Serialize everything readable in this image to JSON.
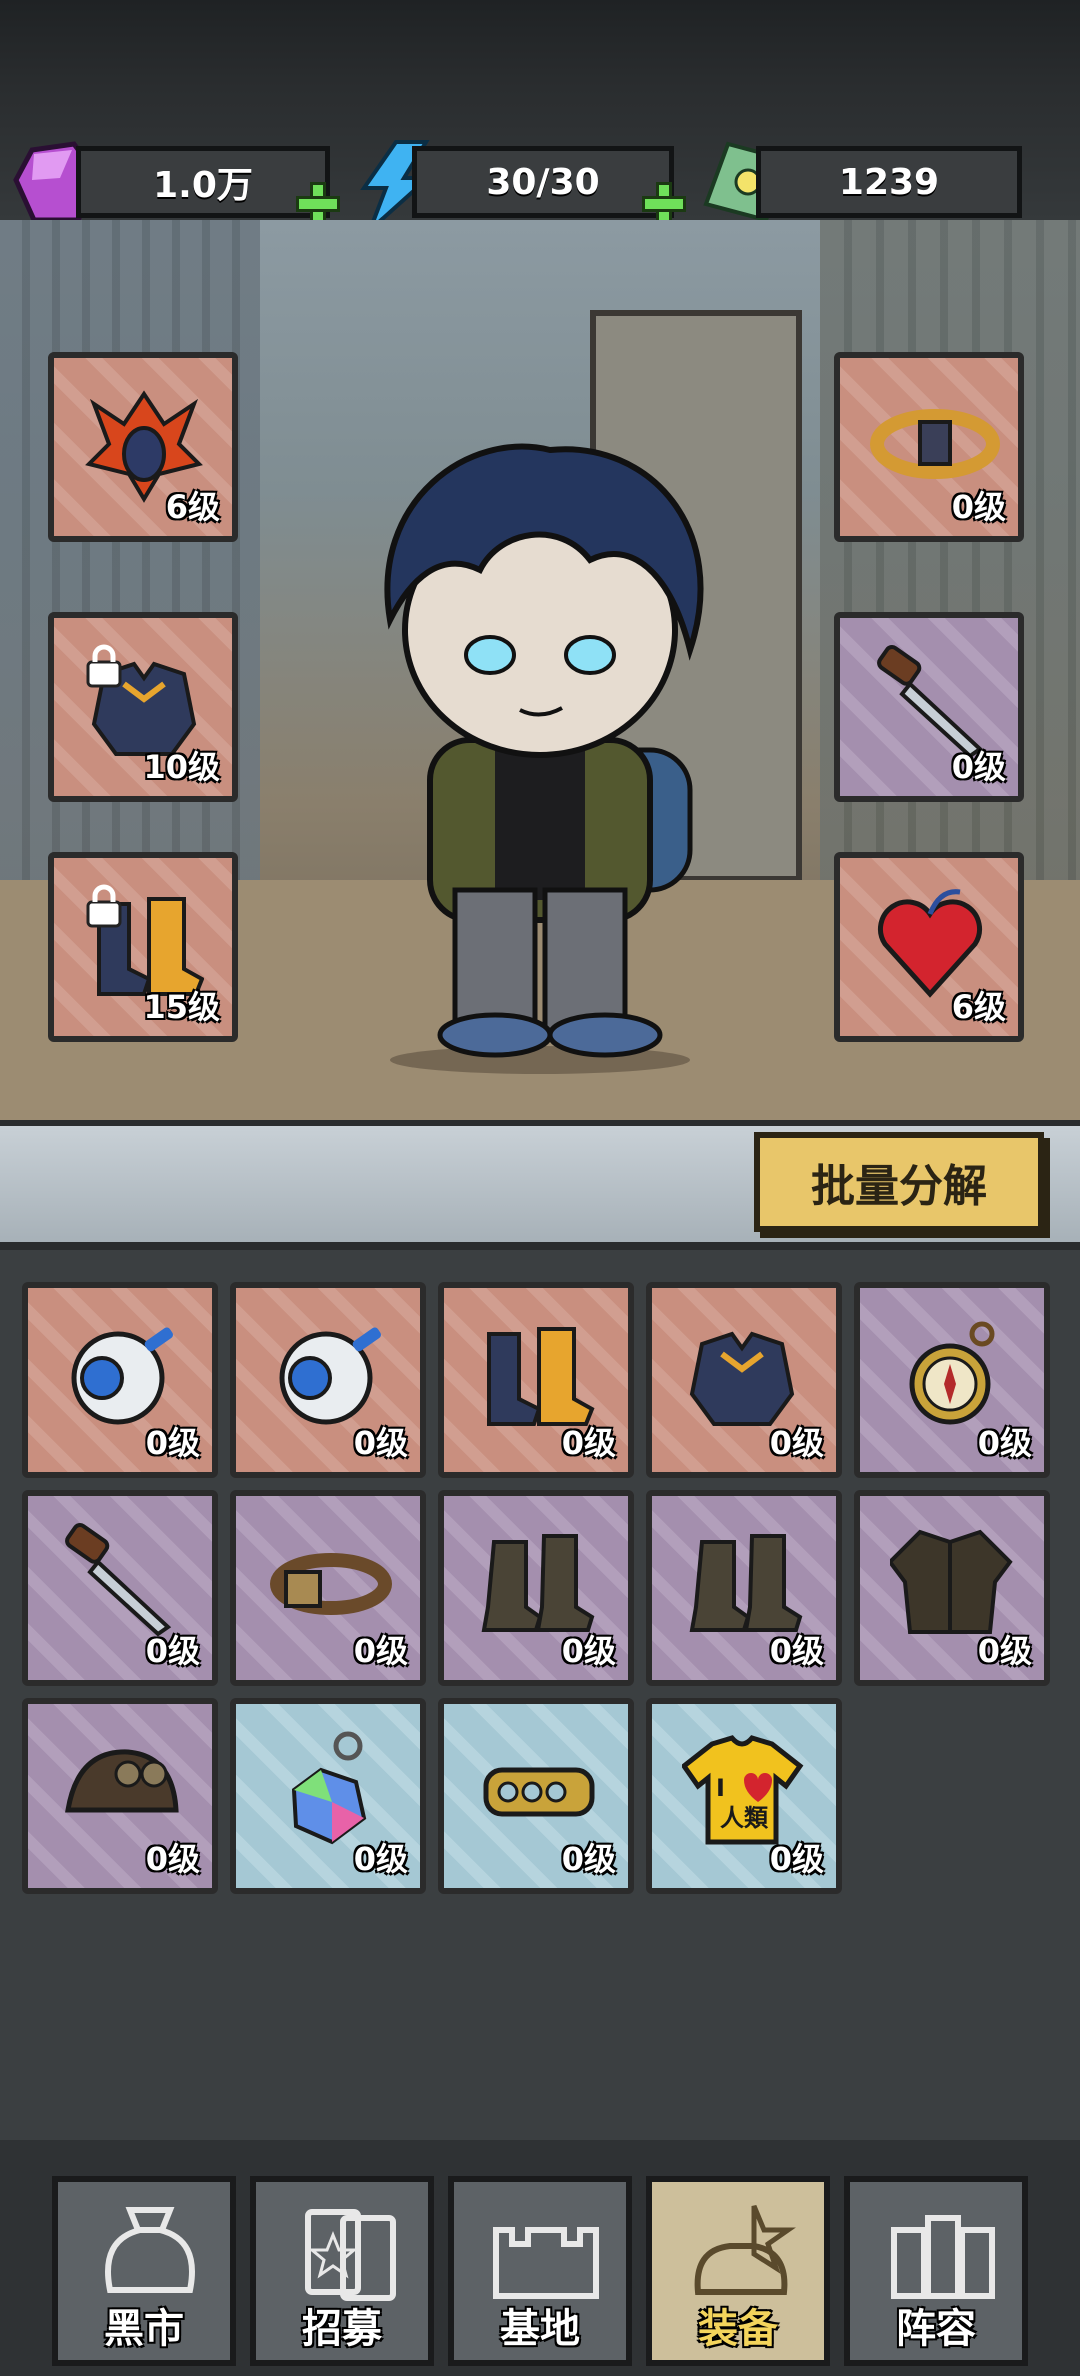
{
  "resources": {
    "gems": "1.0万",
    "energy": "30/30",
    "cash": "1239"
  },
  "equipped": {
    "left": [
      {
        "name": "helmet-phoenix",
        "level": "6级",
        "rarity": "orange",
        "locked": false
      },
      {
        "name": "armor-chest",
        "level": "10级",
        "rarity": "orange",
        "locked": true
      },
      {
        "name": "boots-armor",
        "level": "15级",
        "rarity": "orange",
        "locked": true
      }
    ],
    "right": [
      {
        "name": "belt-gold",
        "level": "0级",
        "rarity": "orange",
        "locked": false
      },
      {
        "name": "knife",
        "level": "0级",
        "rarity": "purple",
        "locked": false
      },
      {
        "name": "heart-pendant",
        "level": "6级",
        "rarity": "orange",
        "locked": false
      }
    ]
  },
  "batch_button": "批量分解",
  "inventory": [
    {
      "icon": "robot-helmet-icon",
      "level": "0级",
      "rarity": "orange"
    },
    {
      "icon": "robot-helmet-icon",
      "level": "0级",
      "rarity": "orange"
    },
    {
      "icon": "armored-boots-icon",
      "level": "0级",
      "rarity": "orange"
    },
    {
      "icon": "chest-armor-icon",
      "level": "0级",
      "rarity": "orange"
    },
    {
      "icon": "compass-icon",
      "level": "0级",
      "rarity": "purple"
    },
    {
      "icon": "knife-icon",
      "level": "0级",
      "rarity": "purple"
    },
    {
      "icon": "belt-icon",
      "level": "0级",
      "rarity": "purple"
    },
    {
      "icon": "leather-boots-icon",
      "level": "0级",
      "rarity": "purple"
    },
    {
      "icon": "leather-boots-icon",
      "level": "0级",
      "rarity": "purple"
    },
    {
      "icon": "jacket-icon",
      "level": "0级",
      "rarity": "purple"
    },
    {
      "icon": "aviator-cap-icon",
      "level": "0级",
      "rarity": "purple"
    },
    {
      "icon": "crystal-keychain-icon",
      "level": "0级",
      "rarity": "blue"
    },
    {
      "icon": "brass-knuckles-icon",
      "level": "0级",
      "rarity": "blue"
    },
    {
      "icon": "tshirt-icon",
      "level": "0级",
      "rarity": "blue"
    }
  ],
  "tshirt_text": {
    "line1": "I",
    "line2": "人類"
  },
  "tabs": [
    {
      "label": "黑市",
      "active": false
    },
    {
      "label": "招募",
      "active": false
    },
    {
      "label": "基地",
      "active": false
    },
    {
      "label": "装备",
      "active": true
    },
    {
      "label": "阵容",
      "active": false
    }
  ],
  "colors": {
    "orange_card": "#c98f7f",
    "purple_card": "#a48fae",
    "blue_card": "#a5c8d4",
    "accent_button": "#e8c66a",
    "plus_green": "#6fe05a",
    "active_tab_label": "#f3d45c"
  }
}
